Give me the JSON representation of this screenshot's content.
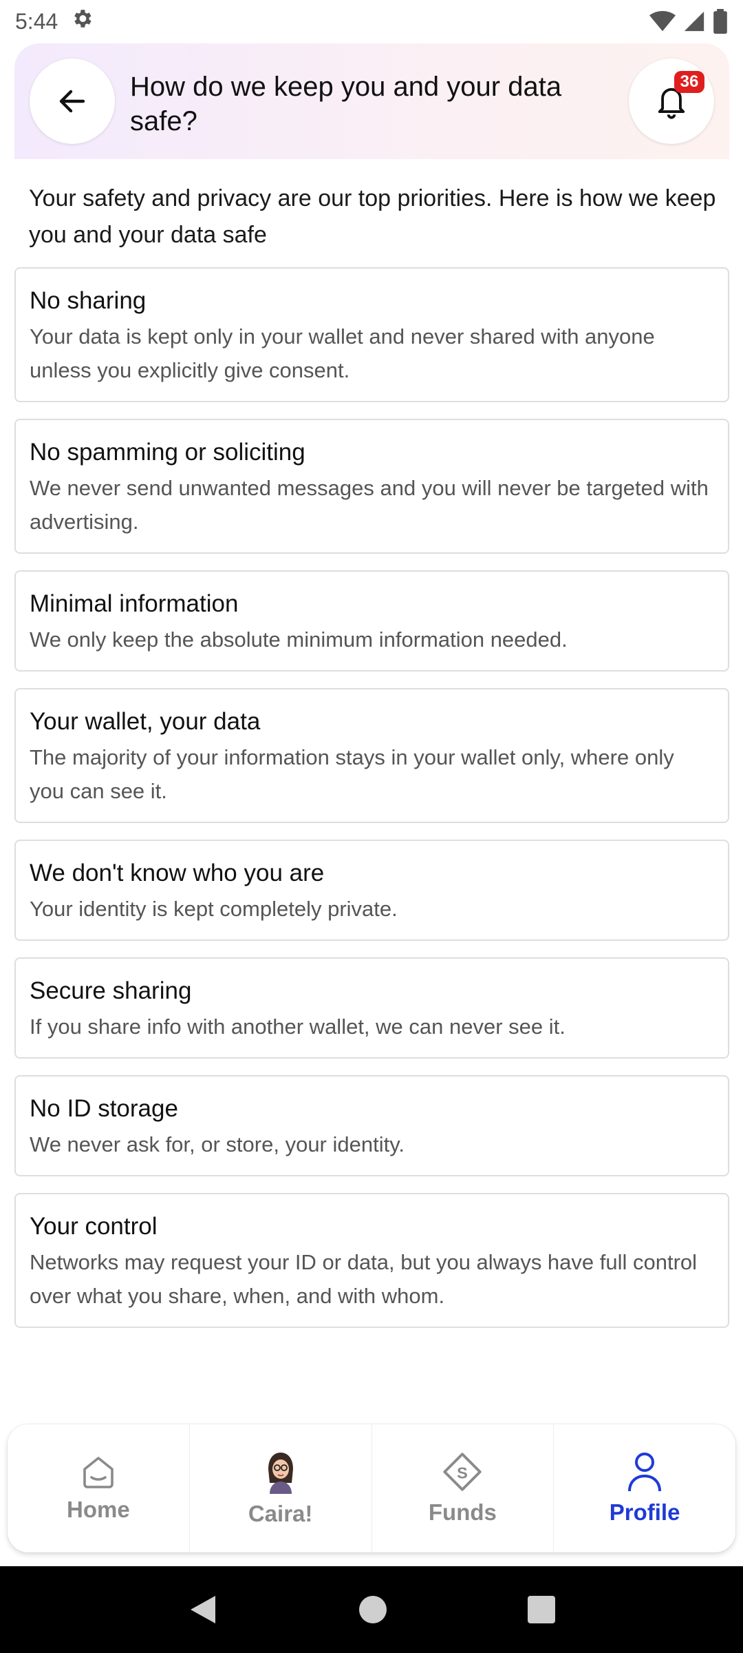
{
  "status_bar": {
    "time": "5:44"
  },
  "header": {
    "title": "How do we keep you and your data safe?",
    "notification_count": "36"
  },
  "intro": "Your safety and privacy are our top priorities. Here is how we keep you and your data safe",
  "cards": [
    {
      "title": "No sharing",
      "desc": "Your data is kept only in your wallet and never shared with anyone unless you explicitly give consent."
    },
    {
      "title": "No spamming or soliciting",
      "desc": "We never send unwanted messages and you will never be targeted with advertising."
    },
    {
      "title": "Minimal information",
      "desc": "We only keep the absolute minimum information needed."
    },
    {
      "title": "Your wallet, your data",
      "desc": "The majority of your information stays in your wallet only, where only you can see it."
    },
    {
      "title": "We don't know who you are",
      "desc": "Your identity is kept completely private."
    },
    {
      "title": "Secure sharing",
      "desc": "If you share info with another wallet, we can never see it."
    },
    {
      "title": "No ID storage",
      "desc": "We never ask for, or store, your identity."
    },
    {
      "title": "Your control",
      "desc": "Networks may request your ID or data, but you always have full control over what you share, when, and with whom."
    }
  ],
  "nav": {
    "home": "Home",
    "caira": "Caira!",
    "funds": "Funds",
    "profile": "Profile",
    "active": "profile"
  },
  "colors": {
    "accent": "#1f3ad6",
    "badge": "#e01e1e"
  }
}
